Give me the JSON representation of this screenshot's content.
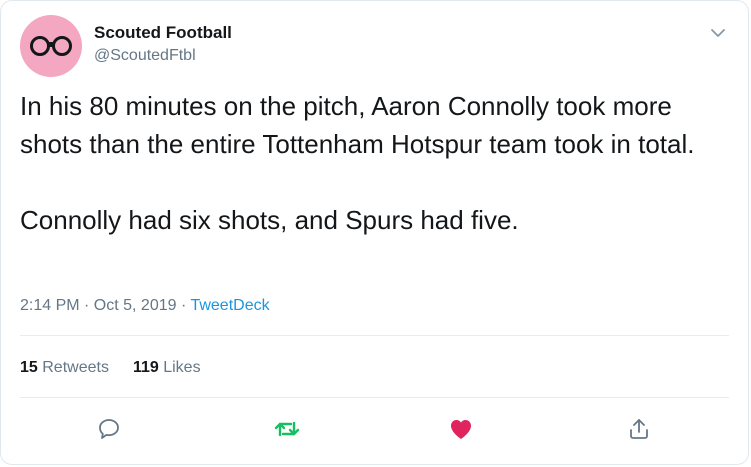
{
  "author": {
    "name": "Scouted Football",
    "handle": "@ScoutedFtbl",
    "avatar_icon": "binoculars-icon",
    "avatar_color": "#f4a7c0"
  },
  "tweet": {
    "text": "In his 80 minutes on the pitch, Aaron Connolly took more shots than the entire Tottenham Hotspur team took in total.\n\nConnolly had six shots, and Spurs had five.",
    "time": "2:14 PM · Oct 5, 2019",
    "separator": "·",
    "source": "TweetDeck"
  },
  "stats": {
    "retweets_count": "15",
    "retweets_label": "Retweets",
    "likes_count": "119",
    "likes_label": "Likes"
  },
  "actions": {
    "reply_icon": "reply-icon",
    "retweet_icon": "retweet-icon",
    "like_icon": "heart-icon",
    "share_icon": "share-icon",
    "retweet_color": "#17bf63",
    "like_color": "#e0245e"
  }
}
